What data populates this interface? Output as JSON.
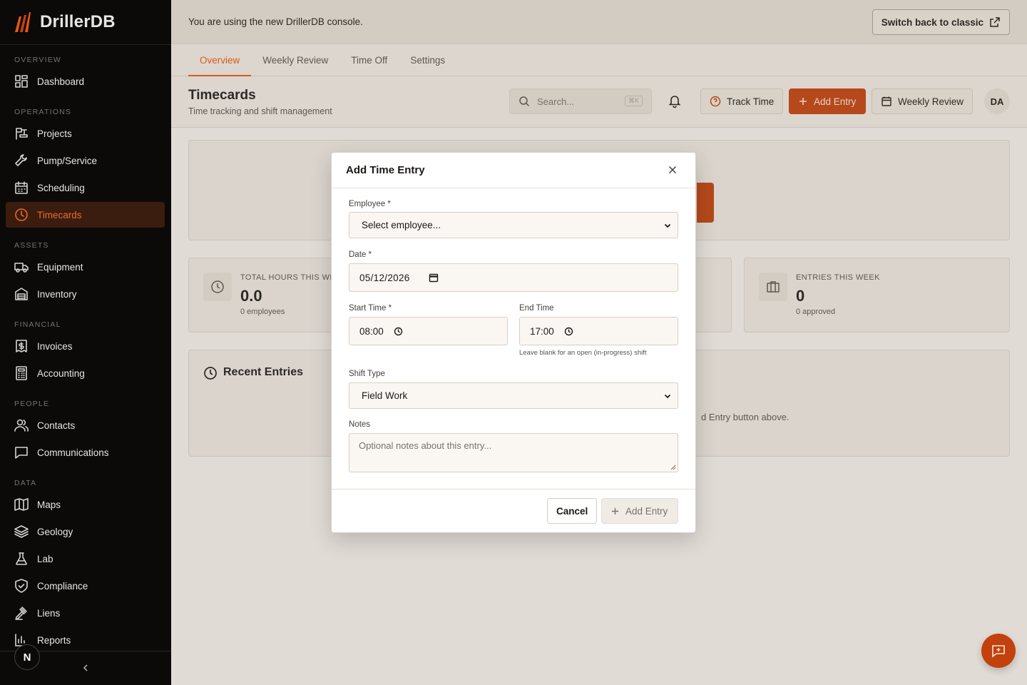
{
  "app": {
    "name": "DrillerDB"
  },
  "sidebar": {
    "sections": [
      {
        "label": "OVERVIEW",
        "items": [
          {
            "label": "Dashboard",
            "icon": "dashboard-icon"
          }
        ]
      },
      {
        "label": "OPERATIONS",
        "items": [
          {
            "label": "Projects",
            "icon": "drill-rig-icon"
          },
          {
            "label": "Pump/Service",
            "icon": "wrench-icon"
          },
          {
            "label": "Scheduling",
            "icon": "calendar-icon"
          },
          {
            "label": "Timecards",
            "icon": "clock-icon",
            "active": true
          }
        ]
      },
      {
        "label": "ASSETS",
        "items": [
          {
            "label": "Equipment",
            "icon": "truck-icon"
          },
          {
            "label": "Inventory",
            "icon": "warehouse-icon"
          }
        ]
      },
      {
        "label": "FINANCIAL",
        "items": [
          {
            "label": "Invoices",
            "icon": "invoice-icon"
          },
          {
            "label": "Accounting",
            "icon": "calculator-icon"
          }
        ]
      },
      {
        "label": "PEOPLE",
        "items": [
          {
            "label": "Contacts",
            "icon": "users-icon"
          },
          {
            "label": "Communications",
            "icon": "message-icon"
          }
        ]
      },
      {
        "label": "DATA",
        "items": [
          {
            "label": "Maps",
            "icon": "map-icon"
          },
          {
            "label": "Geology",
            "icon": "layers-icon"
          },
          {
            "label": "Lab",
            "icon": "flask-icon"
          },
          {
            "label": "Compliance",
            "icon": "shield-icon"
          },
          {
            "label": "Liens",
            "icon": "gavel-icon"
          },
          {
            "label": "Reports",
            "icon": "bar-chart-icon"
          }
        ]
      }
    ],
    "footer_badge": "N"
  },
  "banner": {
    "text": "You are using the new DrillerDB console.",
    "switch_label": "Switch back to classic"
  },
  "tabs": [
    "Overview",
    "Weekly Review",
    "Time Off",
    "Settings"
  ],
  "header": {
    "title": "Timecards",
    "subtitle": "Time tracking and shift management",
    "search_placeholder": "Search...",
    "search_shortcut": "⌘K",
    "track_time": "Track Time",
    "add_entry": "Add Entry",
    "weekly_review": "Weekly Review",
    "avatar": "DA"
  },
  "stats": [
    {
      "label": "TOTAL HOURS THIS WEEK",
      "value": "0.0",
      "sub": "0 employees"
    },
    {
      "label": "ENTRIES THIS WEEK",
      "value": "0",
      "sub": "0 approved"
    }
  ],
  "recent": {
    "title": "Recent Entries",
    "empty_partial": "d Entry button above."
  },
  "modal": {
    "title": "Add Time Entry",
    "employee_label": "Employee *",
    "employee_value": "Select employee...",
    "date_label": "Date *",
    "date_value": "05/12/2026",
    "start_label": "Start Time *",
    "start_value": "08:00",
    "end_label": "End Time",
    "end_value": "17:00",
    "end_hint": "Leave blank for an open (in-progress) shift",
    "shift_label": "Shift Type",
    "shift_value": "Field Work",
    "notes_label": "Notes",
    "notes_placeholder": "Optional notes about this entry...",
    "cancel": "Cancel",
    "add": "Add Entry"
  },
  "colors": {
    "accent": "#ea580c",
    "sidebar_bg": "#0c0a09",
    "active_bg": "#3b1d10"
  }
}
